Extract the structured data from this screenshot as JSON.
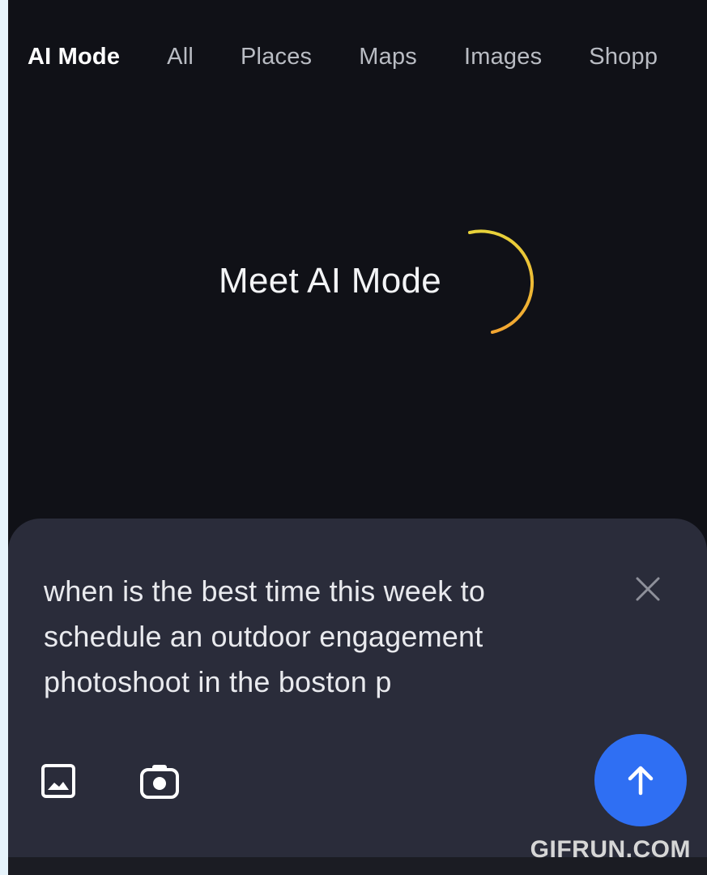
{
  "tabs": [
    {
      "label": "AI Mode",
      "active": true
    },
    {
      "label": "All",
      "active": false
    },
    {
      "label": "Places",
      "active": false
    },
    {
      "label": "Maps",
      "active": false
    },
    {
      "label": "Images",
      "active": false
    },
    {
      "label": "Shopp",
      "active": false
    }
  ],
  "hero": {
    "title": "Meet AI Mode"
  },
  "search": {
    "query": "when is the best time this week to schedule an outdoor engagement photoshoot in the boston p",
    "clear_icon": "close-icon",
    "image_icon": "image-icon",
    "camera_icon": "camera-icon",
    "send_icon": "arrow-up-icon"
  },
  "watermark": "GIFRUN.COM",
  "colors": {
    "background": "#101117",
    "panel": "#2a2c3a",
    "send_button": "#2f6ff3",
    "arc_start": "#e8d23a",
    "arc_end": "#f2a531"
  }
}
